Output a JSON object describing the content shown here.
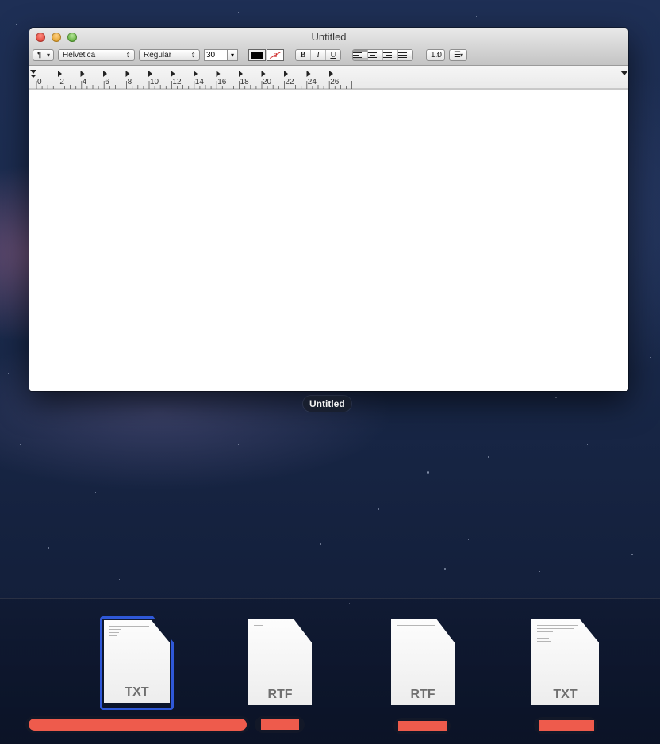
{
  "window": {
    "title": "Untitled",
    "label_below": "Untitled"
  },
  "toolbar": {
    "paragraph_menu": "¶",
    "font_family": "Helvetica",
    "font_style": "Regular",
    "font_size": "30",
    "bold_label": "B",
    "italic_label": "I",
    "underline_label": "U",
    "line_spacing": "1.0",
    "text_color": "#000000"
  },
  "ruler": {
    "marks": [
      "0",
      "2",
      "4",
      "6",
      "8",
      "10",
      "12",
      "14",
      "16",
      "18",
      "20",
      "22",
      "24",
      "26"
    ]
  },
  "documents": [
    {
      "ext": "TXT",
      "selected": true
    },
    {
      "ext": "RTF",
      "selected": false
    },
    {
      "ext": "RTF",
      "selected": false
    },
    {
      "ext": "TXT",
      "selected": false
    }
  ],
  "colors": {
    "accent_selection": "#2f58d8",
    "redaction": "#ee5b4c"
  }
}
